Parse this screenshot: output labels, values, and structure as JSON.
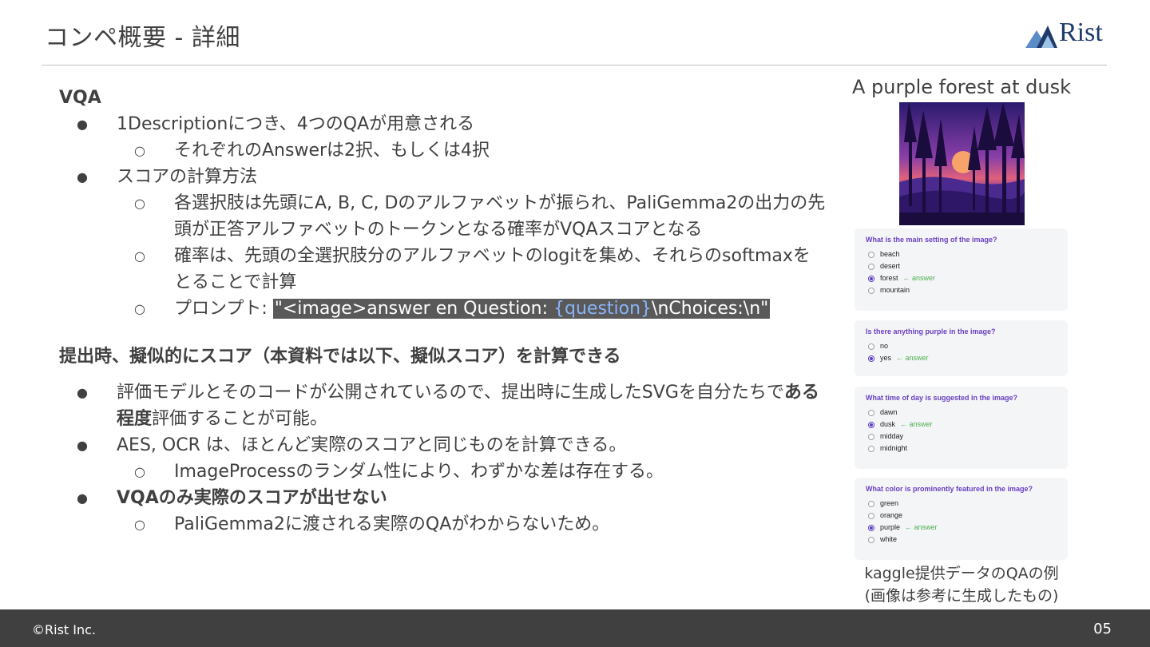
{
  "header": {
    "title": "コンペ概要 - 詳細",
    "logo_text": "Rist"
  },
  "sections": {
    "vqa_head": "VQA",
    "vqa_items": {
      "b1": "1Descriptionにつき、4つのQAが用意される",
      "b1_s1": "それぞれのAnswerは2択、もしくは4択",
      "b2": "スコアの計算方法",
      "b2_s1": "各選択肢は先頭にA, B, C, Dのアルファベットが振られ、PaliGemma2の出力の先頭が正答アルファベットのトークンとなる確率がVQAスコアとなる",
      "b2_s2": "確率は、先頭の全選択肢分のアルファベットのlogitを集め、それらのsoftmaxをとることで計算",
      "b2_s3_label": "プロンプト: ",
      "prompt_pre": "\"<image>answer en Question: ",
      "prompt_var": "{question}",
      "prompt_post": "\\nChoices:\\n\""
    },
    "submit_head": "提出時、擬似的にスコア（本資料では以下、擬似スコア）を計算できる",
    "submit_items": {
      "b1_pre": "評価モデルとそのコードが公開されているので、提出時に生成したSVGを自分たちで",
      "b1_bold": "ある程度",
      "b1_post": "評価することが可能。",
      "b2": "AES, OCR は、ほとんど実際のスコアと同じものを計算できる。",
      "b2_s1": "ImageProcessのランダム性により、わずかな差は存在する。",
      "b3": "VQAのみ実際のスコアが出せない",
      "b3_s1": "PaliGemma2に渡される実際のQAがわからないため。"
    }
  },
  "sidebar": {
    "image_title": "A purple forest at dusk",
    "answer_marker": "← answer",
    "qa": [
      {
        "question": "What is the main setting of the image?",
        "options": [
          "beach",
          "desert",
          "forest",
          "mountain"
        ],
        "answer_index": 2
      },
      {
        "question": "Is there anything purple in the image?",
        "options": [
          "no",
          "yes"
        ],
        "answer_index": 1
      },
      {
        "question": "What time of day is suggested in the image?",
        "options": [
          "dawn",
          "dusk",
          "midday",
          "midnight"
        ],
        "answer_index": 1
      },
      {
        "question": "What color is prominently featured in the image?",
        "options": [
          "green",
          "orange",
          "purple",
          "white"
        ],
        "answer_index": 2
      }
    ],
    "caption_line1": "kaggle提供データのQAの例",
    "caption_line2": "(画像は参考に生成したもの)"
  },
  "footer": {
    "copyright": "©Rist Inc.",
    "page": "05"
  },
  "colors": {
    "accent_purple": "#6a3fc1",
    "answer_green": "#4caf50",
    "footer_bg": "#404040",
    "prompt_bg": "#595959",
    "prompt_var": "#8ab4f8"
  }
}
